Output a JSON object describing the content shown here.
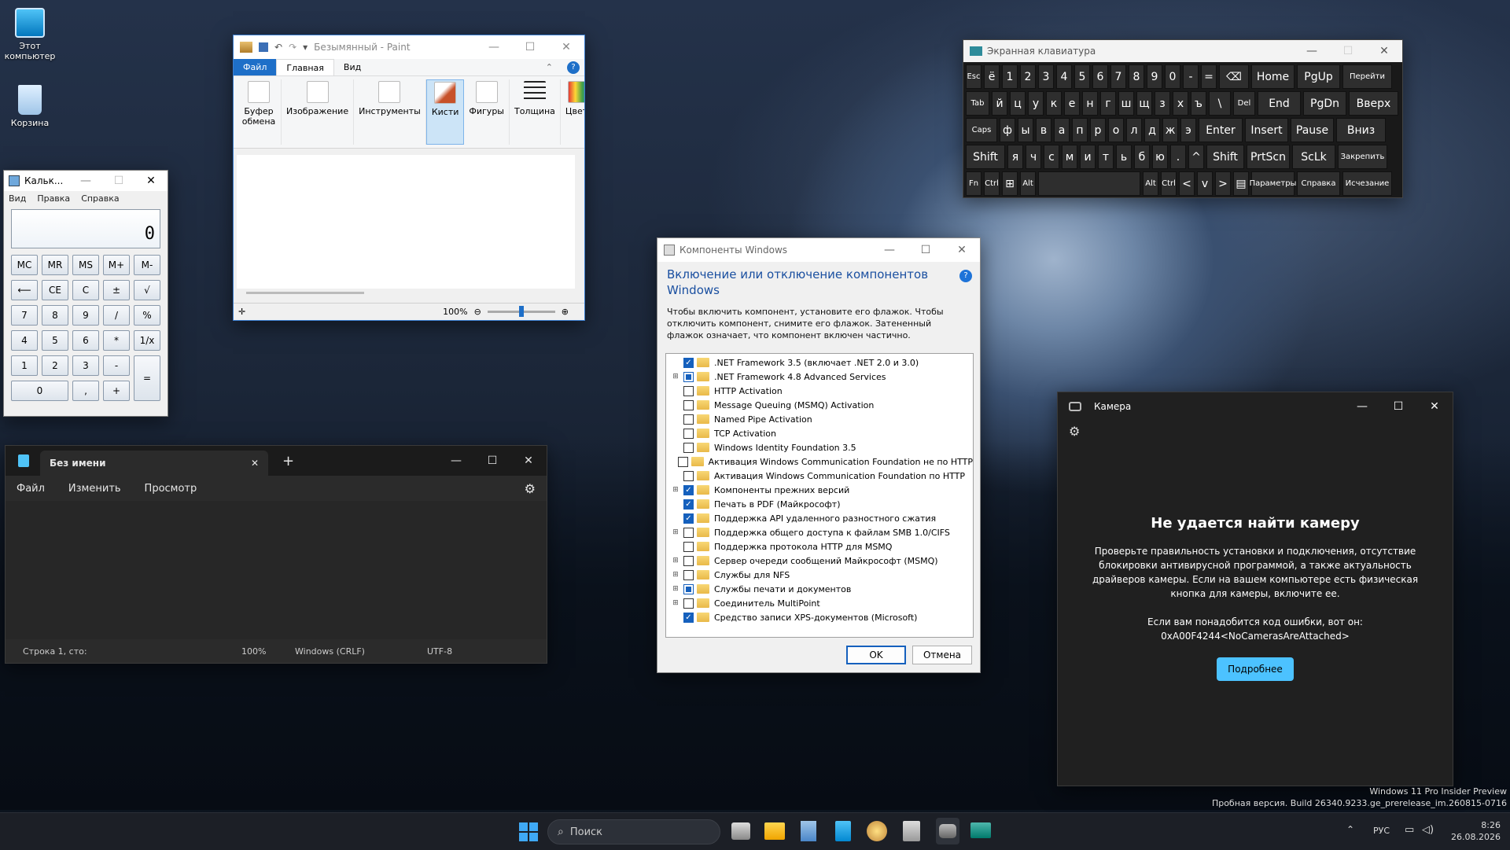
{
  "desktop": {
    "icons": [
      {
        "label": "Этот компьютер"
      },
      {
        "label": "Корзина"
      }
    ]
  },
  "calculator": {
    "title": "Кальк...",
    "menu": [
      "Вид",
      "Правка",
      "Справка"
    ],
    "display": "0",
    "keys": [
      "MC",
      "MR",
      "MS",
      "M+",
      "M-",
      "⟵",
      "CE",
      "C",
      "±",
      "√",
      "7",
      "8",
      "9",
      "/",
      "%",
      "4",
      "5",
      "6",
      "*",
      "1/x",
      "1",
      "2",
      "3",
      "-",
      "=",
      "0",
      ",",
      "+"
    ]
  },
  "paint": {
    "title": "Безымянный - Paint",
    "tabs": [
      "Файл",
      "Главная",
      "Вид"
    ],
    "groups": [
      "Буфер обмена",
      "Изображение",
      "Инструменты",
      "Кисти",
      "Фигуры",
      "Толщина",
      "Цвета"
    ],
    "zoom": "100%"
  },
  "notepad": {
    "tab_title": "Без имени",
    "menu": [
      "Файл",
      "Изменить",
      "Просмотр"
    ],
    "status": {
      "position": "Строка 1, сто:",
      "zoom": "100%",
      "eol": "Windows (CRLF)",
      "encoding": "UTF-8"
    }
  },
  "features": {
    "title": "Компоненты Windows",
    "heading": "Включение или отключение компонентов Windows",
    "description": "Чтобы включить компонент, установите его флажок. Чтобы отключить компонент, снимите его флажок. Затененный флажок означает, что компонент включен частично.",
    "items": [
      {
        "label": ".NET Framework 3.5 (включает .NET 2.0 и 3.0)",
        "state": "on",
        "expand": false,
        "indent": 0
      },
      {
        "label": ".NET Framework 4.8 Advanced Services",
        "state": "part",
        "expand": true,
        "indent": 0
      },
      {
        "label": "HTTP Activation",
        "state": "off",
        "expand": false,
        "indent": 0
      },
      {
        "label": "Message Queuing (MSMQ) Activation",
        "state": "off",
        "expand": false,
        "indent": 0
      },
      {
        "label": "Named Pipe Activation",
        "state": "off",
        "expand": false,
        "indent": 0
      },
      {
        "label": "TCP Activation",
        "state": "off",
        "expand": false,
        "indent": 0
      },
      {
        "label": "Windows Identity Foundation 3.5",
        "state": "off",
        "expand": false,
        "indent": 0
      },
      {
        "label": "Активация Windows Communication Foundation не по HTTP",
        "state": "off",
        "expand": false,
        "indent": 0
      },
      {
        "label": "Активация Windows Communication Foundation по HTTP",
        "state": "off",
        "expand": false,
        "indent": 0
      },
      {
        "label": "Компоненты прежних версий",
        "state": "on",
        "expand": true,
        "indent": 0
      },
      {
        "label": "Печать в PDF (Майкрософт)",
        "state": "on",
        "expand": false,
        "indent": 0
      },
      {
        "label": "Поддержка API удаленного разностного сжатия",
        "state": "on",
        "expand": false,
        "indent": 0
      },
      {
        "label": "Поддержка общего доступа к файлам SMB 1.0/CIFS",
        "state": "off",
        "expand": true,
        "indent": 0
      },
      {
        "label": "Поддержка протокола HTTP для MSMQ",
        "state": "off",
        "expand": false,
        "indent": 0
      },
      {
        "label": "Сервер очереди сообщений Майкрософт (MSMQ)",
        "state": "off",
        "expand": true,
        "indent": 0
      },
      {
        "label": "Службы для NFS",
        "state": "off",
        "expand": true,
        "indent": 0
      },
      {
        "label": "Службы печати и документов",
        "state": "part",
        "expand": true,
        "indent": 0
      },
      {
        "label": "Соединитель MultiPoint",
        "state": "off",
        "expand": true,
        "indent": 0
      },
      {
        "label": "Средство записи XPS-документов (Microsoft)",
        "state": "on",
        "expand": false,
        "indent": 0
      }
    ],
    "ok": "OK",
    "cancel": "Отмена"
  },
  "osk": {
    "title": "Экранная клавиатура",
    "rows": [
      [
        {
          "l": "Esc",
          "w": 20,
          "s": 1
        },
        {
          "l": "ё",
          "w": 20
        },
        {
          "l": "1",
          "w": 20
        },
        {
          "l": "2",
          "w": 20
        },
        {
          "l": "3",
          "w": 20
        },
        {
          "l": "4",
          "w": 20
        },
        {
          "l": "5",
          "w": 20
        },
        {
          "l": "6",
          "w": 20
        },
        {
          "l": "7",
          "w": 20
        },
        {
          "l": "8",
          "w": 20
        },
        {
          "l": "9",
          "w": 20
        },
        {
          "l": "0",
          "w": 20
        },
        {
          "l": "-",
          "w": 20
        },
        {
          "l": "=",
          "w": 20
        },
        {
          "l": "⌫",
          "w": 38
        },
        {
          "l": "Home",
          "w": 55
        },
        {
          "l": "PgUp",
          "w": 55
        },
        {
          "l": "Перейти",
          "w": 63,
          "s": 1
        }
      ],
      [
        {
          "l": "Tab",
          "w": 30,
          "s": 1
        },
        {
          "l": "й",
          "w": 20
        },
        {
          "l": "ц",
          "w": 20
        },
        {
          "l": "у",
          "w": 20
        },
        {
          "l": "к",
          "w": 20
        },
        {
          "l": "е",
          "w": 20
        },
        {
          "l": "н",
          "w": 20
        },
        {
          "l": "г",
          "w": 20
        },
        {
          "l": "ш",
          "w": 20
        },
        {
          "l": "щ",
          "w": 20
        },
        {
          "l": "з",
          "w": 20
        },
        {
          "l": "х",
          "w": 20
        },
        {
          "l": "ъ",
          "w": 20
        },
        {
          "l": "\\",
          "w": 28
        },
        {
          "l": "Del",
          "w": 28,
          "s": 1
        },
        {
          "l": "End",
          "w": 55
        },
        {
          "l": "PgDn",
          "w": 55
        },
        {
          "l": "Вверх",
          "w": 63
        }
      ],
      [
        {
          "l": "Caps",
          "w": 40,
          "s": 1
        },
        {
          "l": "ф",
          "w": 20
        },
        {
          "l": "ы",
          "w": 20
        },
        {
          "l": "в",
          "w": 20
        },
        {
          "l": "а",
          "w": 20
        },
        {
          "l": "п",
          "w": 20
        },
        {
          "l": "р",
          "w": 20
        },
        {
          "l": "о",
          "w": 20
        },
        {
          "l": "л",
          "w": 20
        },
        {
          "l": "д",
          "w": 20
        },
        {
          "l": "ж",
          "w": 20
        },
        {
          "l": "э",
          "w": 20
        },
        {
          "l": "Enter",
          "w": 56
        },
        {
          "l": "Insert",
          "w": 55
        },
        {
          "l": "Pause",
          "w": 55
        },
        {
          "l": "Вниз",
          "w": 63
        }
      ],
      [
        {
          "l": "Shift",
          "w": 50
        },
        {
          "l": "я",
          "w": 20
        },
        {
          "l": "ч",
          "w": 20
        },
        {
          "l": "с",
          "w": 20
        },
        {
          "l": "м",
          "w": 20
        },
        {
          "l": "и",
          "w": 20
        },
        {
          "l": "т",
          "w": 20
        },
        {
          "l": "ь",
          "w": 20
        },
        {
          "l": "б",
          "w": 20
        },
        {
          "l": "ю",
          "w": 20
        },
        {
          "l": ".",
          "w": 20
        },
        {
          "l": "^",
          "w": 20
        },
        {
          "l": "Shift",
          "w": 48
        },
        {
          "l": "PrtScn",
          "w": 55
        },
        {
          "l": "ScLk",
          "w": 55
        },
        {
          "l": "Закрепить",
          "w": 63,
          "s": 1
        }
      ],
      [
        {
          "l": "Fn",
          "w": 20,
          "s": 1
        },
        {
          "l": "Ctrl",
          "w": 20,
          "s": 1
        },
        {
          "l": "⊞",
          "w": 20
        },
        {
          "l": "Alt",
          "w": 20,
          "s": 1
        },
        {
          "l": "",
          "w": 130
        },
        {
          "l": "Alt",
          "w": 20,
          "s": 1
        },
        {
          "l": "Ctrl",
          "w": 20,
          "s": 1
        },
        {
          "l": "<",
          "w": 20
        },
        {
          "l": "v",
          "w": 20
        },
        {
          "l": ">",
          "w": 20
        },
        {
          "l": "▤",
          "w": 20
        },
        {
          "l": "Параметры",
          "w": 55,
          "s": 1
        },
        {
          "l": "Справка",
          "w": 55,
          "s": 1
        },
        {
          "l": "Исчезание",
          "w": 63,
          "s": 1
        }
      ]
    ]
  },
  "camera": {
    "title": "Камера",
    "heading": "Не удается найти камеру",
    "body": [
      "Проверьте правильность установки и подключения, отсутствие",
      "блокировки антивирусной программой, а также актуальность",
      "драйверов камеры. Если на вашем компьютере есть физическая",
      "кнопка для камеры, включите ее."
    ],
    "error_intro": "Если вам понадобится код ошибки, вот он:",
    "error_code": "0xA00F4244<NoCamerasAreAttached>",
    "button": "Подробнее"
  },
  "watermark": [
    "Windows 11 Pro Insider Preview",
    "Пробная версия. Build 26340.9233.ge_prerelease_im.260815-0716"
  ],
  "taskbar": {
    "search": "Поиск",
    "lang": "РУС",
    "time": "8:26",
    "date": "26.08.2026"
  }
}
